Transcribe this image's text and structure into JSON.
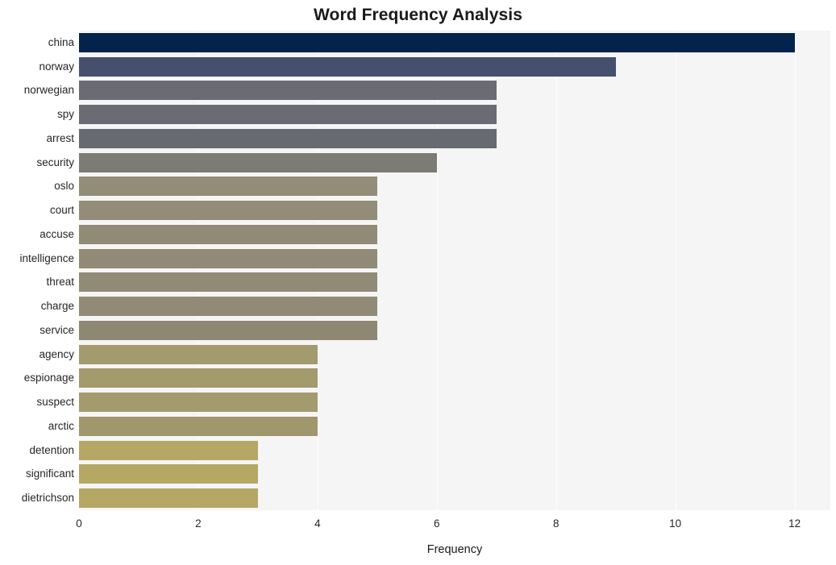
{
  "chart_data": {
    "type": "bar",
    "orientation": "horizontal",
    "title": "Word Frequency Analysis",
    "xlabel": "Frequency",
    "ylabel": "",
    "xlim": [
      0,
      12.6
    ],
    "ylim": null,
    "grid": true,
    "legend": null,
    "x_ticks": [
      "0",
      "2",
      "4",
      "6",
      "8",
      "10",
      "12"
    ],
    "x_tick_values": [
      0,
      2,
      4,
      6,
      8,
      10,
      12
    ],
    "categories": [
      "china",
      "norway",
      "norwegian",
      "spy",
      "arrest",
      "security",
      "oslo",
      "court",
      "accuse",
      "intelligence",
      "threat",
      "charge",
      "service",
      "agency",
      "espionage",
      "suspect",
      "arctic",
      "detention",
      "significant",
      "dietrichson"
    ],
    "values": [
      12,
      9,
      7,
      7,
      7,
      6,
      5,
      5,
      5,
      5,
      5,
      5,
      5,
      4,
      4,
      4,
      4,
      3,
      3,
      3
    ],
    "bar_colors": [
      "#04234c",
      "#44506e",
      "#6a6b73",
      "#6b6c73",
      "#686a72",
      "#7c7b74",
      "#938c78",
      "#938c78",
      "#918a76",
      "#918a76",
      "#918a76",
      "#918a76",
      "#8e8873",
      "#a39a6d",
      "#a39a6d",
      "#a39a6d",
      "#a0976c",
      "#b5a764",
      "#b5a764",
      "#b5a764"
    ],
    "plot_background": "#f5f5f6",
    "figure_background": "#ffffff",
    "gridline_color": "#ffffff",
    "text_color": "#262626"
  }
}
